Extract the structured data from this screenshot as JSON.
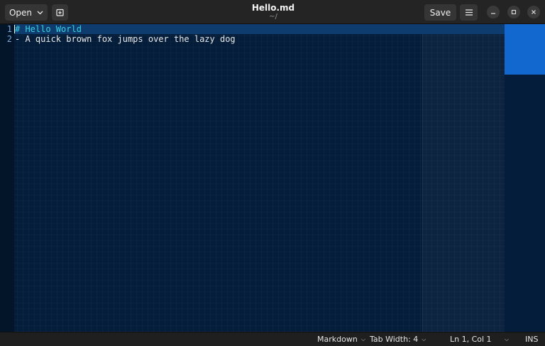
{
  "header": {
    "open_label": "Open",
    "title": "Hello.md",
    "subtitle": "~/",
    "save_label": "Save"
  },
  "editor": {
    "lines": [
      {
        "number": "1",
        "text": "# Hello World"
      },
      {
        "number": "2",
        "text": "- A quick brown fox jumps over the lazy dog"
      }
    ]
  },
  "statusbar": {
    "language": "Markdown",
    "tab_width": "Tab Width: 4",
    "position": "Ln 1, Col 1",
    "mode": "INS"
  },
  "colors": {
    "editor_background": "#041d3a",
    "current_line": "#0e3c6e",
    "heading_text": "#3ad0e6",
    "overview_slider": "#1268cf"
  },
  "icons": [
    "chevron-down-icon",
    "new-tab-icon",
    "hamburger-menu-icon",
    "minimize-icon",
    "maximize-icon",
    "close-icon"
  ]
}
